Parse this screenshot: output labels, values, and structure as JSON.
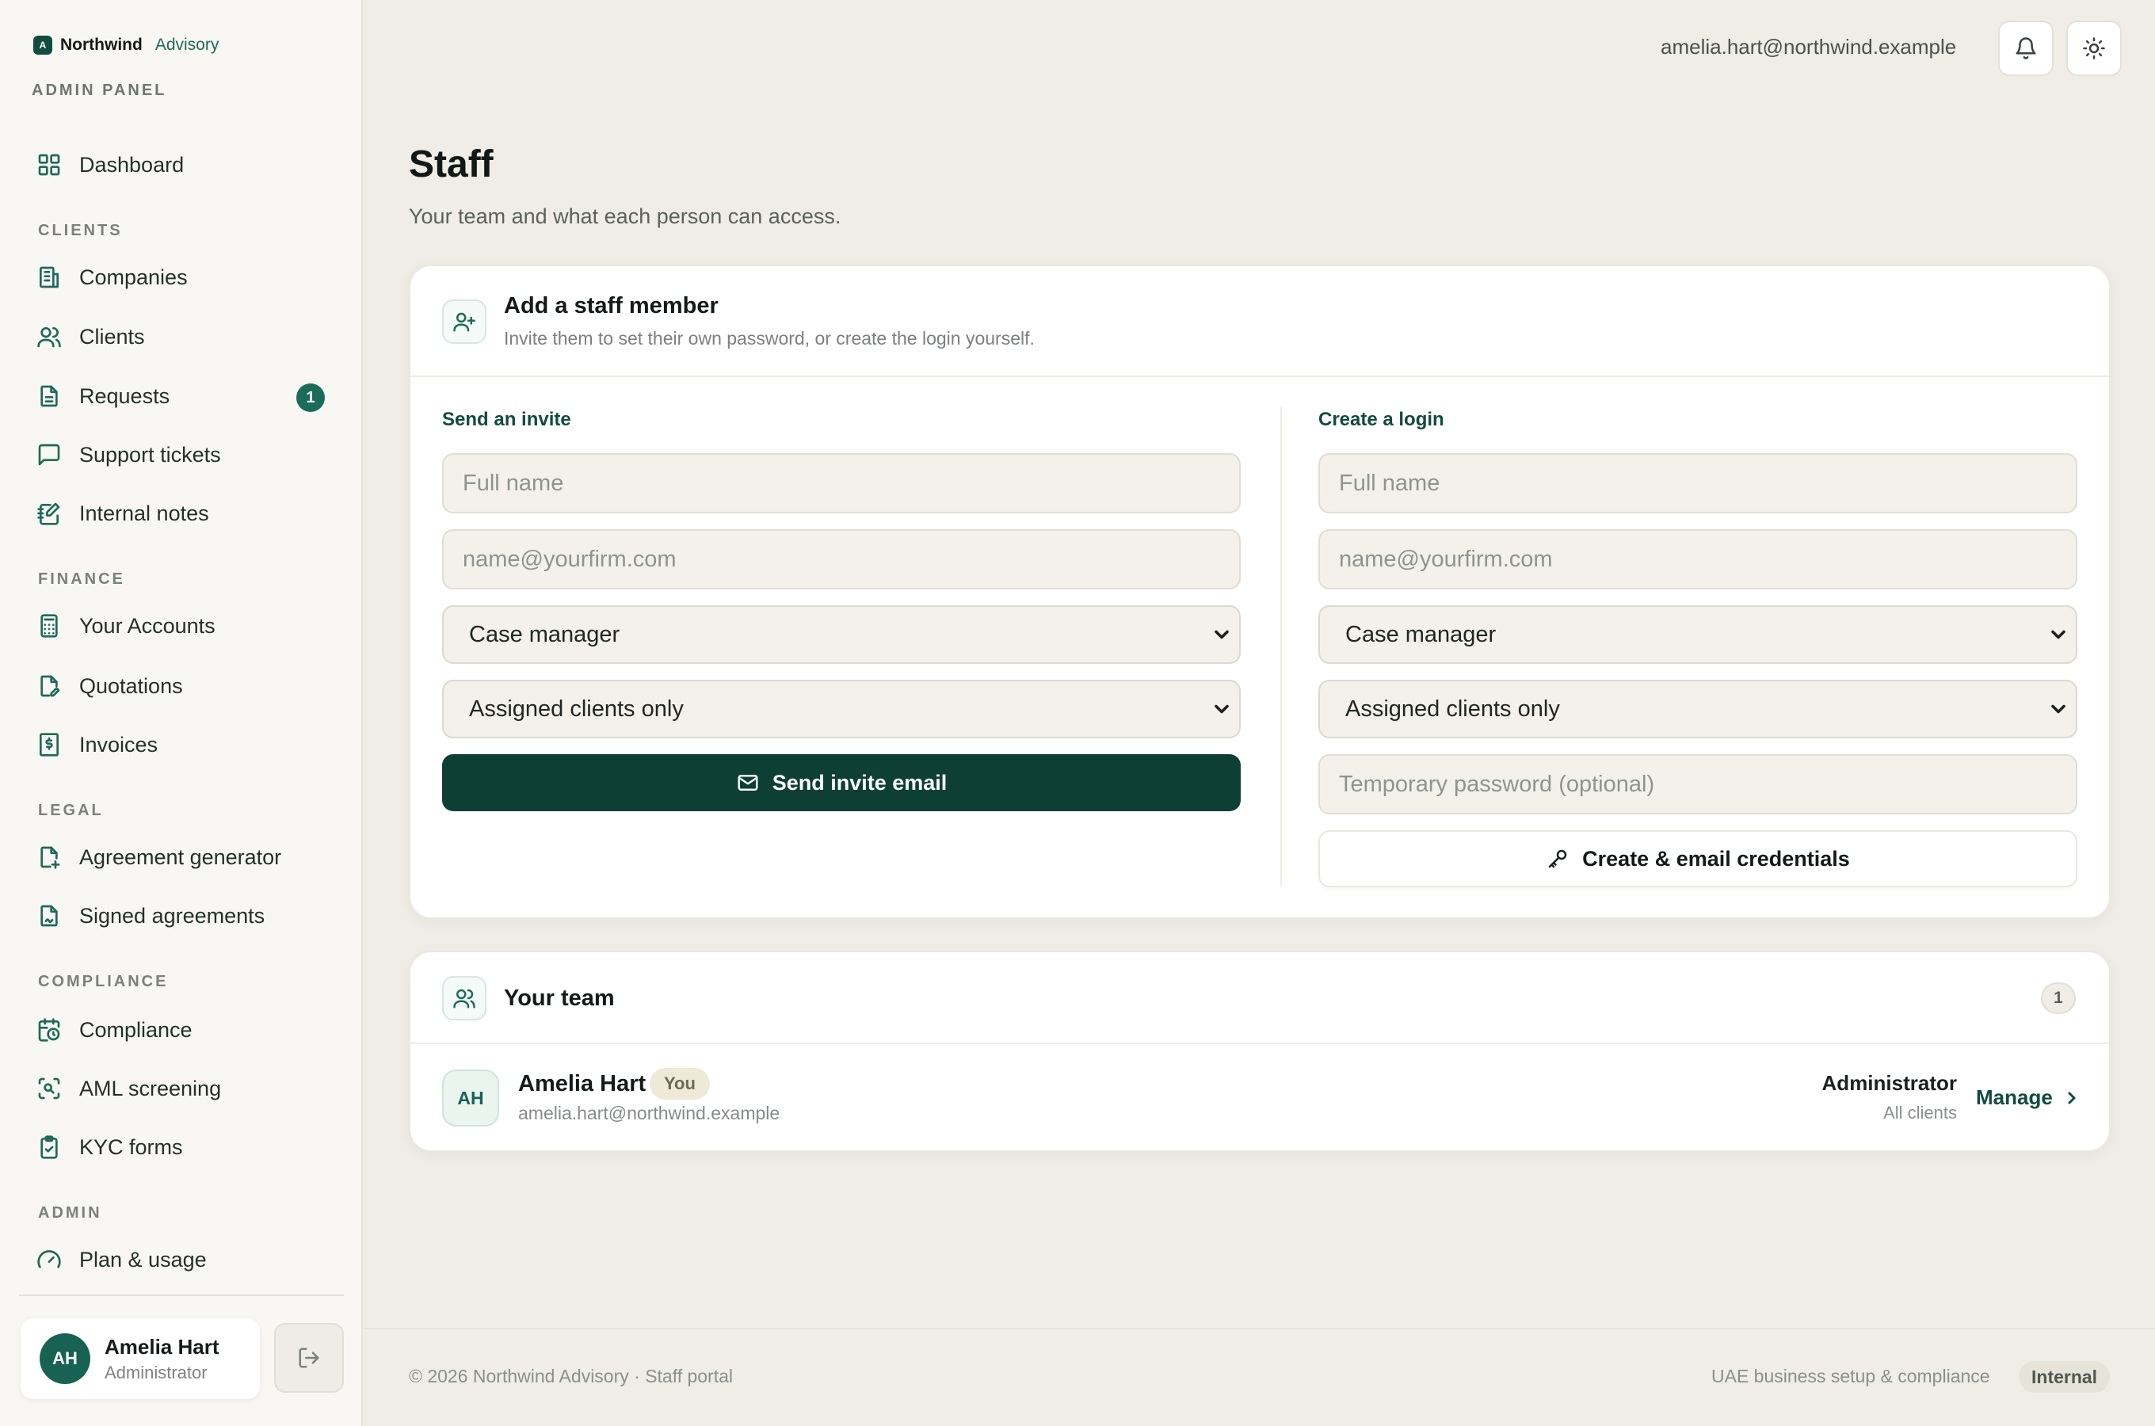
{
  "brand": {
    "mark": "A",
    "name": "Northwind",
    "sub": "Advisory",
    "panel_label": "ADMIN PANEL"
  },
  "nav": {
    "dashboard": "Dashboard",
    "sections": {
      "clients": "CLIENTS",
      "finance": "FINANCE",
      "legal": "LEGAL",
      "compliance": "COMPLIANCE",
      "admin": "ADMIN"
    },
    "items": {
      "companies": "Companies",
      "clients": "Clients",
      "requests": "Requests",
      "requests_badge": "1",
      "support_tickets": "Support tickets",
      "internal_notes": "Internal notes",
      "your_accounts": "Your Accounts",
      "quotations": "Quotations",
      "invoices": "Invoices",
      "agreement_generator": "Agreement generator",
      "signed_agreements": "Signed agreements",
      "compliance": "Compliance",
      "aml_screening": "AML screening",
      "kyc_forms": "KYC forms",
      "plan_usage": "Plan & usage"
    }
  },
  "sidebar_user": {
    "initials": "AH",
    "name": "Amelia Hart",
    "role": "Administrator"
  },
  "topbar": {
    "email": "amelia.hart@northwind.example",
    "notifications_icon": "bell-icon",
    "theme_icon": "sun-icon"
  },
  "page": {
    "title": "Staff",
    "subtitle": "Your team and what each person can access."
  },
  "add_staff": {
    "title": "Add a staff member",
    "subtitle": "Invite them to set their own password, or create the login yourself.",
    "invite": {
      "label": "Send an invite",
      "name_placeholder": "Full name",
      "email_placeholder": "name@yourfirm.com",
      "role_value": "Case manager",
      "access_value": "Assigned clients only",
      "button": "Send invite email"
    },
    "create": {
      "label": "Create a login",
      "name_placeholder": "Full name",
      "email_placeholder": "name@yourfirm.com",
      "role_value": "Case manager",
      "access_value": "Assigned clients only",
      "password_placeholder": "Temporary password (optional)",
      "button": "Create & email credentials"
    }
  },
  "team": {
    "title": "Your team",
    "count": "1",
    "members": [
      {
        "initials": "AH",
        "name": "Amelia Hart",
        "badge": "You",
        "email": "amelia.hart@northwind.example",
        "role": "Administrator",
        "scope": "All clients",
        "action": "Manage"
      }
    ]
  },
  "footer": {
    "left": "© 2026 Northwind Advisory · Staff portal",
    "right": "UAE business setup & compliance",
    "tag": "Internal"
  },
  "colors": {
    "accent": "#124b3f",
    "accent_light": "#1f6a58",
    "background": "#efede5",
    "card": "#ffffff"
  }
}
